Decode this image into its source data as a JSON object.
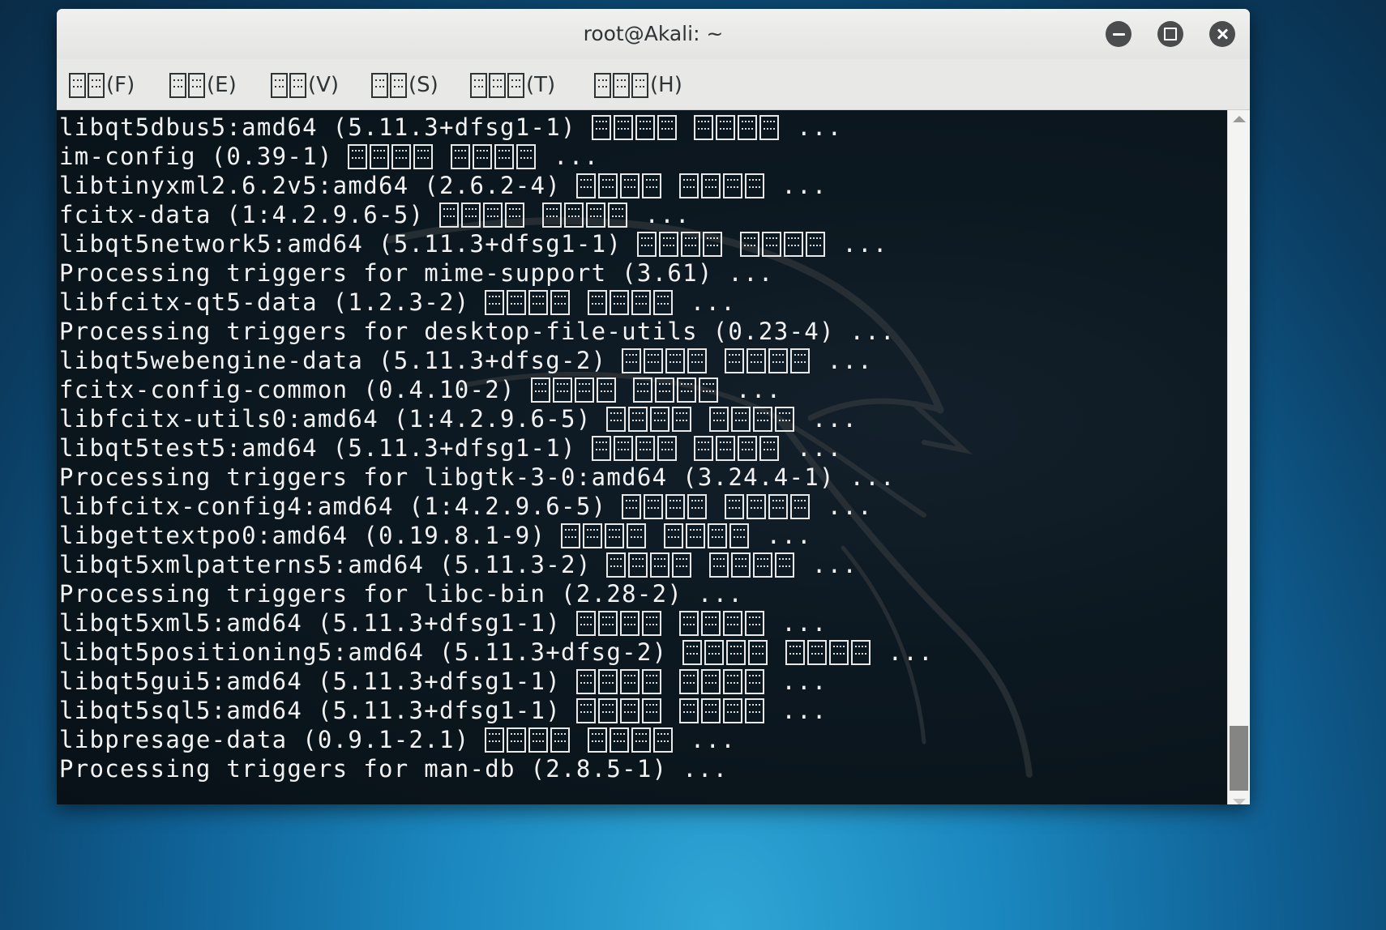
{
  "window": {
    "title": "root@Akali: ~"
  },
  "menus": [
    {
      "glyph_boxes": 2,
      "suffix": "(F)"
    },
    {
      "glyph_boxes": 2,
      "suffix": "(E)"
    },
    {
      "glyph_boxes": 2,
      "suffix": "(V)"
    },
    {
      "glyph_boxes": 2,
      "suffix": "(S)"
    },
    {
      "glyph_boxes": 3,
      "suffix": "(T)"
    },
    {
      "glyph_boxes": 3,
      "suffix": "(H)"
    }
  ],
  "terminal": {
    "lines": [
      {
        "text": "libqt5dbus5:amd64 (5.11.3+dfsg1-1) ",
        "boxes": true,
        "tail": " ..."
      },
      {
        "text": "im-config (0.39-1) ",
        "boxes": true,
        "tail": " ..."
      },
      {
        "text": "libtinyxml2.6.2v5:amd64 (2.6.2-4) ",
        "boxes": true,
        "tail": " ..."
      },
      {
        "text": "fcitx-data (1:4.2.9.6-5) ",
        "boxes": true,
        "tail": " ..."
      },
      {
        "text": "libqt5network5:amd64 (5.11.3+dfsg1-1) ",
        "boxes": true,
        "tail": " ..."
      },
      {
        "text": "Processing triggers for mime-support (3.61) ...",
        "boxes": false,
        "tail": ""
      },
      {
        "text": "libfcitx-qt5-data (1.2.3-2) ",
        "boxes": true,
        "tail": " ..."
      },
      {
        "text": "Processing triggers for desktop-file-utils (0.23-4) ...",
        "boxes": false,
        "tail": ""
      },
      {
        "text": "libqt5webengine-data (5.11.3+dfsg-2) ",
        "boxes": true,
        "tail": " ..."
      },
      {
        "text": "fcitx-config-common (0.4.10-2) ",
        "boxes": true,
        "tail": " ..."
      },
      {
        "text": "libfcitx-utils0:amd64 (1:4.2.9.6-5) ",
        "boxes": true,
        "tail": " ..."
      },
      {
        "text": "libqt5test5:amd64 (5.11.3+dfsg1-1) ",
        "boxes": true,
        "tail": " ..."
      },
      {
        "text": "Processing triggers for libgtk-3-0:amd64 (3.24.4-1) ...",
        "boxes": false,
        "tail": ""
      },
      {
        "text": "libfcitx-config4:amd64 (1:4.2.9.6-5) ",
        "boxes": true,
        "tail": " ..."
      },
      {
        "text": "libgettextpo0:amd64 (0.19.8.1-9) ",
        "boxes": true,
        "tail": " ..."
      },
      {
        "text": "libqt5xmlpatterns5:amd64 (5.11.3-2) ",
        "boxes": true,
        "tail": " ..."
      },
      {
        "text": "Processing triggers for libc-bin (2.28-2) ...",
        "boxes": false,
        "tail": ""
      },
      {
        "text": "libqt5xml5:amd64 (5.11.3+dfsg1-1) ",
        "boxes": true,
        "tail": " ..."
      },
      {
        "text": "libqt5positioning5:amd64 (5.11.3+dfsg-2) ",
        "boxes": true,
        "tail": " ..."
      },
      {
        "text": "libqt5gui5:amd64 (5.11.3+dfsg1-1) ",
        "boxes": true,
        "tail": " ..."
      },
      {
        "text": "libqt5sql5:amd64 (5.11.3+dfsg1-1) ",
        "boxes": true,
        "tail": " ..."
      },
      {
        "text": "libpresage-data (0.9.1-2.1) ",
        "boxes": true,
        "tail": " ..."
      },
      {
        "text": "Processing triggers for man-db (2.8.5-1) ...",
        "boxes": false,
        "tail": ""
      }
    ]
  },
  "colors": {
    "terminal_bg": "#0c1820",
    "terminal_fg": "#f2f2f2",
    "titlebar_bg": "#e8e8e7",
    "window_button": "#4a4c4d"
  }
}
